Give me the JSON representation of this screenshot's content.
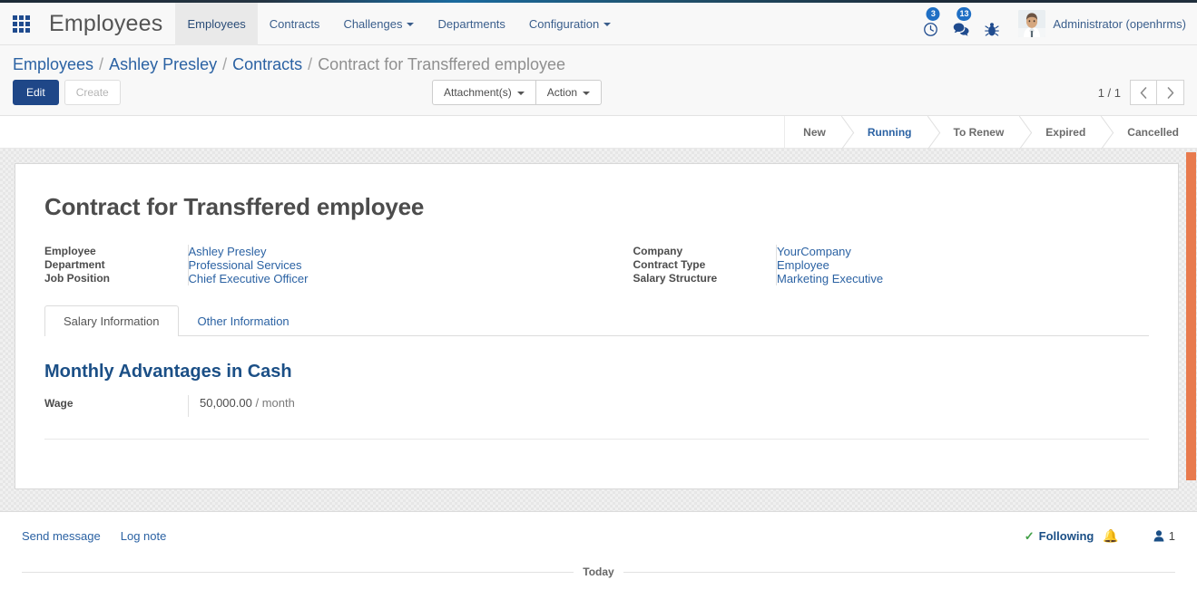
{
  "navbar": {
    "apps_icon": "apps-grid-icon",
    "brand": "Employees",
    "menu": [
      {
        "label": "Employees",
        "active": true,
        "dropdown": false
      },
      {
        "label": "Contracts",
        "active": false,
        "dropdown": false
      },
      {
        "label": "Challenges",
        "active": false,
        "dropdown": true
      },
      {
        "label": "Departments",
        "active": false,
        "dropdown": false
      },
      {
        "label": "Configuration",
        "active": false,
        "dropdown": true
      }
    ],
    "activities_icon": "clock-icon",
    "activities_badge": "3",
    "messages_icon": "chat-bubble-icon",
    "messages_badge": "13",
    "debug_icon": "bug-icon",
    "avatar_icon": "user-avatar",
    "username": "Administrator (openhrms)"
  },
  "control_panel": {
    "breadcrumb": [
      {
        "label": "Employees",
        "link": true
      },
      {
        "label": "Ashley Presley",
        "link": true
      },
      {
        "label": "Contracts",
        "link": true
      },
      {
        "label": "Contract for Transffered employee",
        "link": false
      }
    ],
    "separator": "/",
    "edit_label": "Edit",
    "create_label": "Create",
    "attachments_label": "Attachment(s)",
    "action_label": "Action",
    "pager_counter": "1 / 1",
    "prev_icon": "chevron-left-icon",
    "next_icon": "chevron-right-icon"
  },
  "statusbar": {
    "items": [
      {
        "label": "New",
        "active": false
      },
      {
        "label": "Running",
        "active": true
      },
      {
        "label": "To Renew",
        "active": false
      },
      {
        "label": "Expired",
        "active": false
      },
      {
        "label": "Cancelled",
        "active": false
      }
    ]
  },
  "form": {
    "title": "Contract for Transffered employee",
    "left_fields": [
      {
        "label": "Employee",
        "value": "Ashley Presley"
      },
      {
        "label": "Department",
        "value": "Professional Services"
      },
      {
        "label": "Job Position",
        "value": "Chief Executive Officer"
      }
    ],
    "right_fields": [
      {
        "label": "Company",
        "value": "YourCompany"
      },
      {
        "label": "Contract Type",
        "value": "Employee"
      },
      {
        "label": "Salary Structure",
        "value": "Marketing Executive"
      }
    ],
    "tabs": [
      {
        "label": "Salary Information",
        "active": true
      },
      {
        "label": "Other Information",
        "active": false
      }
    ],
    "section_title": "Monthly Advantages in Cash",
    "wage_label": "Wage",
    "wage_value": "50,000.00",
    "wage_suffix": "/ month"
  },
  "chatter": {
    "send_message_label": "Send message",
    "log_note_label": "Log note",
    "following_label": "Following",
    "check_icon": "check-icon",
    "bell_icon": "bell-icon",
    "followers_icon": "user-icon",
    "followers_count": "1",
    "today_label": "Today"
  },
  "colors": {
    "primary_button": "#1f4788",
    "link": "#2b62a3",
    "scrollbar": "#e87a4d",
    "badge": "#1f6fc4",
    "following_check": "#42a047"
  }
}
